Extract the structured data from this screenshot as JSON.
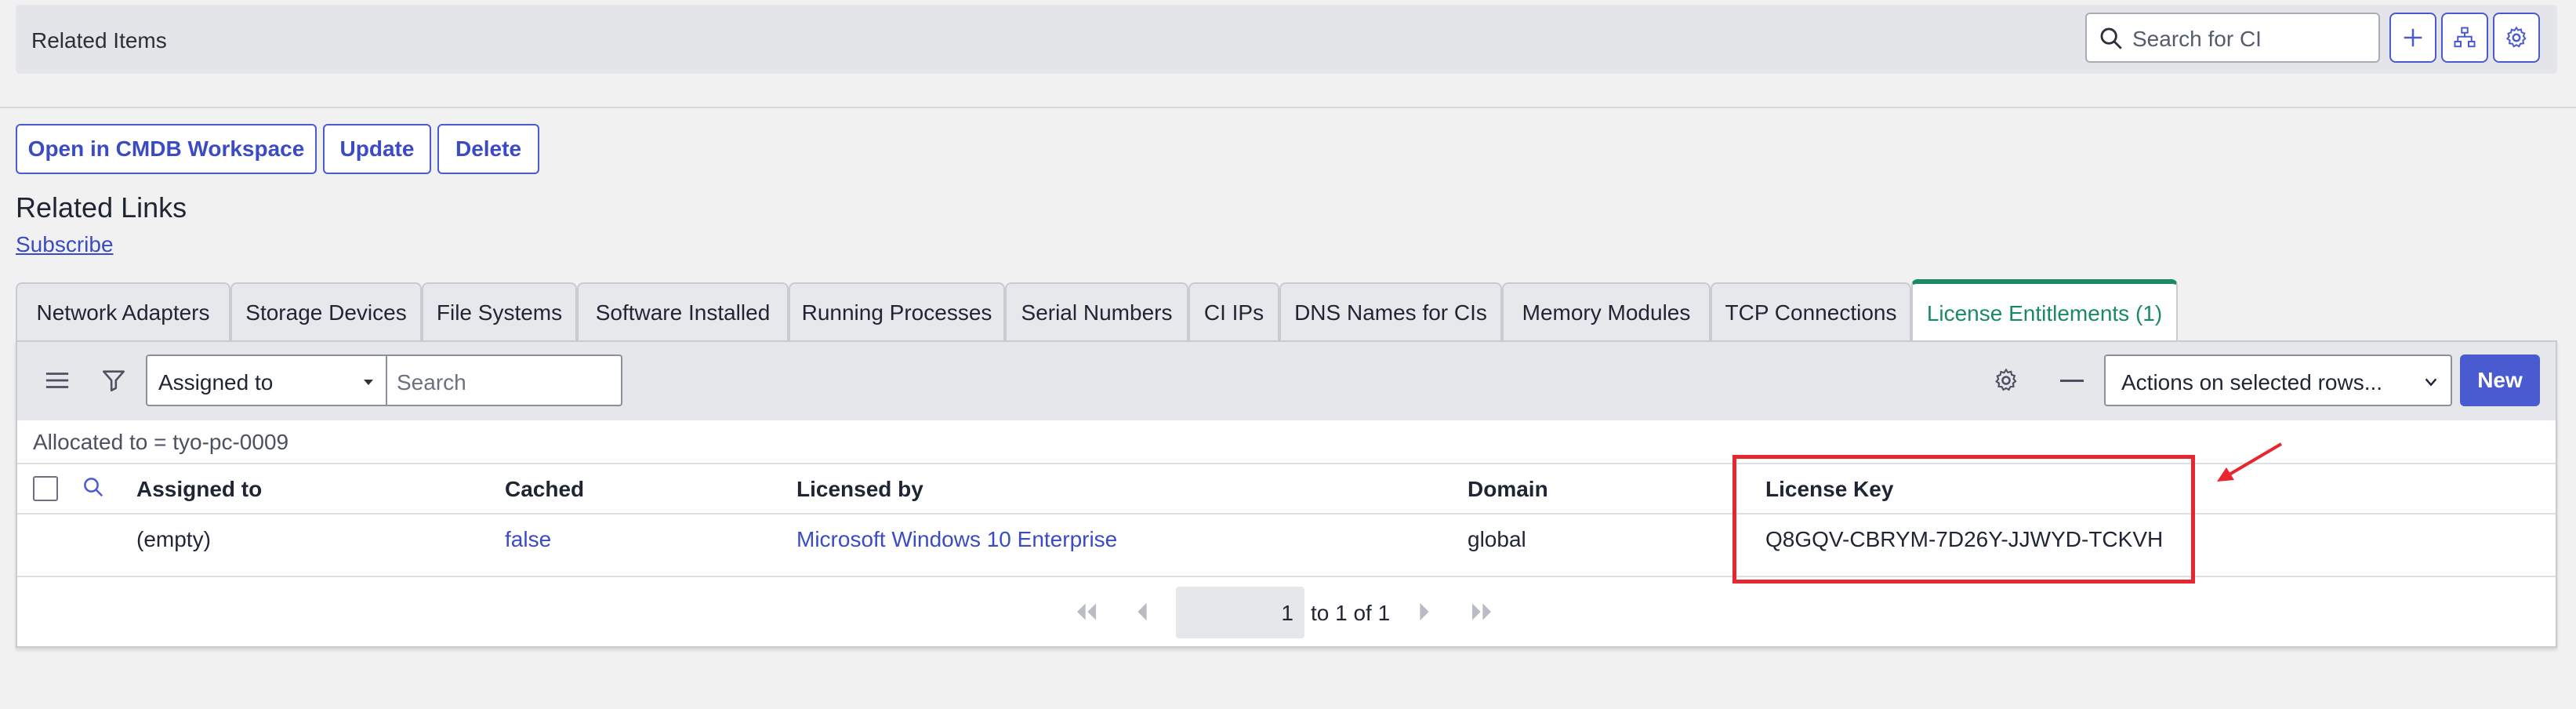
{
  "related_items": {
    "title": "Related Items",
    "search_placeholder": "Search for CI",
    "icons": [
      "search-icon",
      "plus-icon",
      "hierarchy-icon",
      "gear-icon"
    ]
  },
  "actions": {
    "open_cmdb": "Open in CMDB Workspace",
    "update": "Update",
    "delete": "Delete"
  },
  "related_links": {
    "title": "Related Links",
    "subscribe": "Subscribe"
  },
  "tabs": [
    {
      "label": "Network Adapters"
    },
    {
      "label": "Storage Devices"
    },
    {
      "label": "File Systems"
    },
    {
      "label": "Software Installed"
    },
    {
      "label": "Running Processes"
    },
    {
      "label": "Serial Numbers"
    },
    {
      "label": "CI IPs"
    },
    {
      "label": "DNS Names for CIs"
    },
    {
      "label": "Memory Modules"
    },
    {
      "label": "TCP Connections"
    },
    {
      "label": "License Entitlements (1)",
      "active": true
    }
  ],
  "list_toolbar": {
    "field_select": "Assigned to",
    "search_placeholder": "Search",
    "actions_select": "Actions on selected rows...",
    "new_label": "New"
  },
  "filter_breadcrumb": "Allocated to = tyo-pc-0009",
  "table": {
    "columns": [
      "Assigned to",
      "Cached",
      "Licensed by",
      "Domain",
      "License Key"
    ],
    "rows": [
      [
        "(empty)",
        "false",
        "Microsoft Windows 10 Enterprise",
        "global",
        "Q8GQV-CBRYM-7D26Y-JJWYD-TCKVH"
      ]
    ]
  },
  "pagination": {
    "page": "1",
    "range": "to 1 of 1"
  },
  "colors": {
    "accent": "#4a5bd1",
    "active_tab": "#1a8a62",
    "highlight": "#e8262f"
  }
}
